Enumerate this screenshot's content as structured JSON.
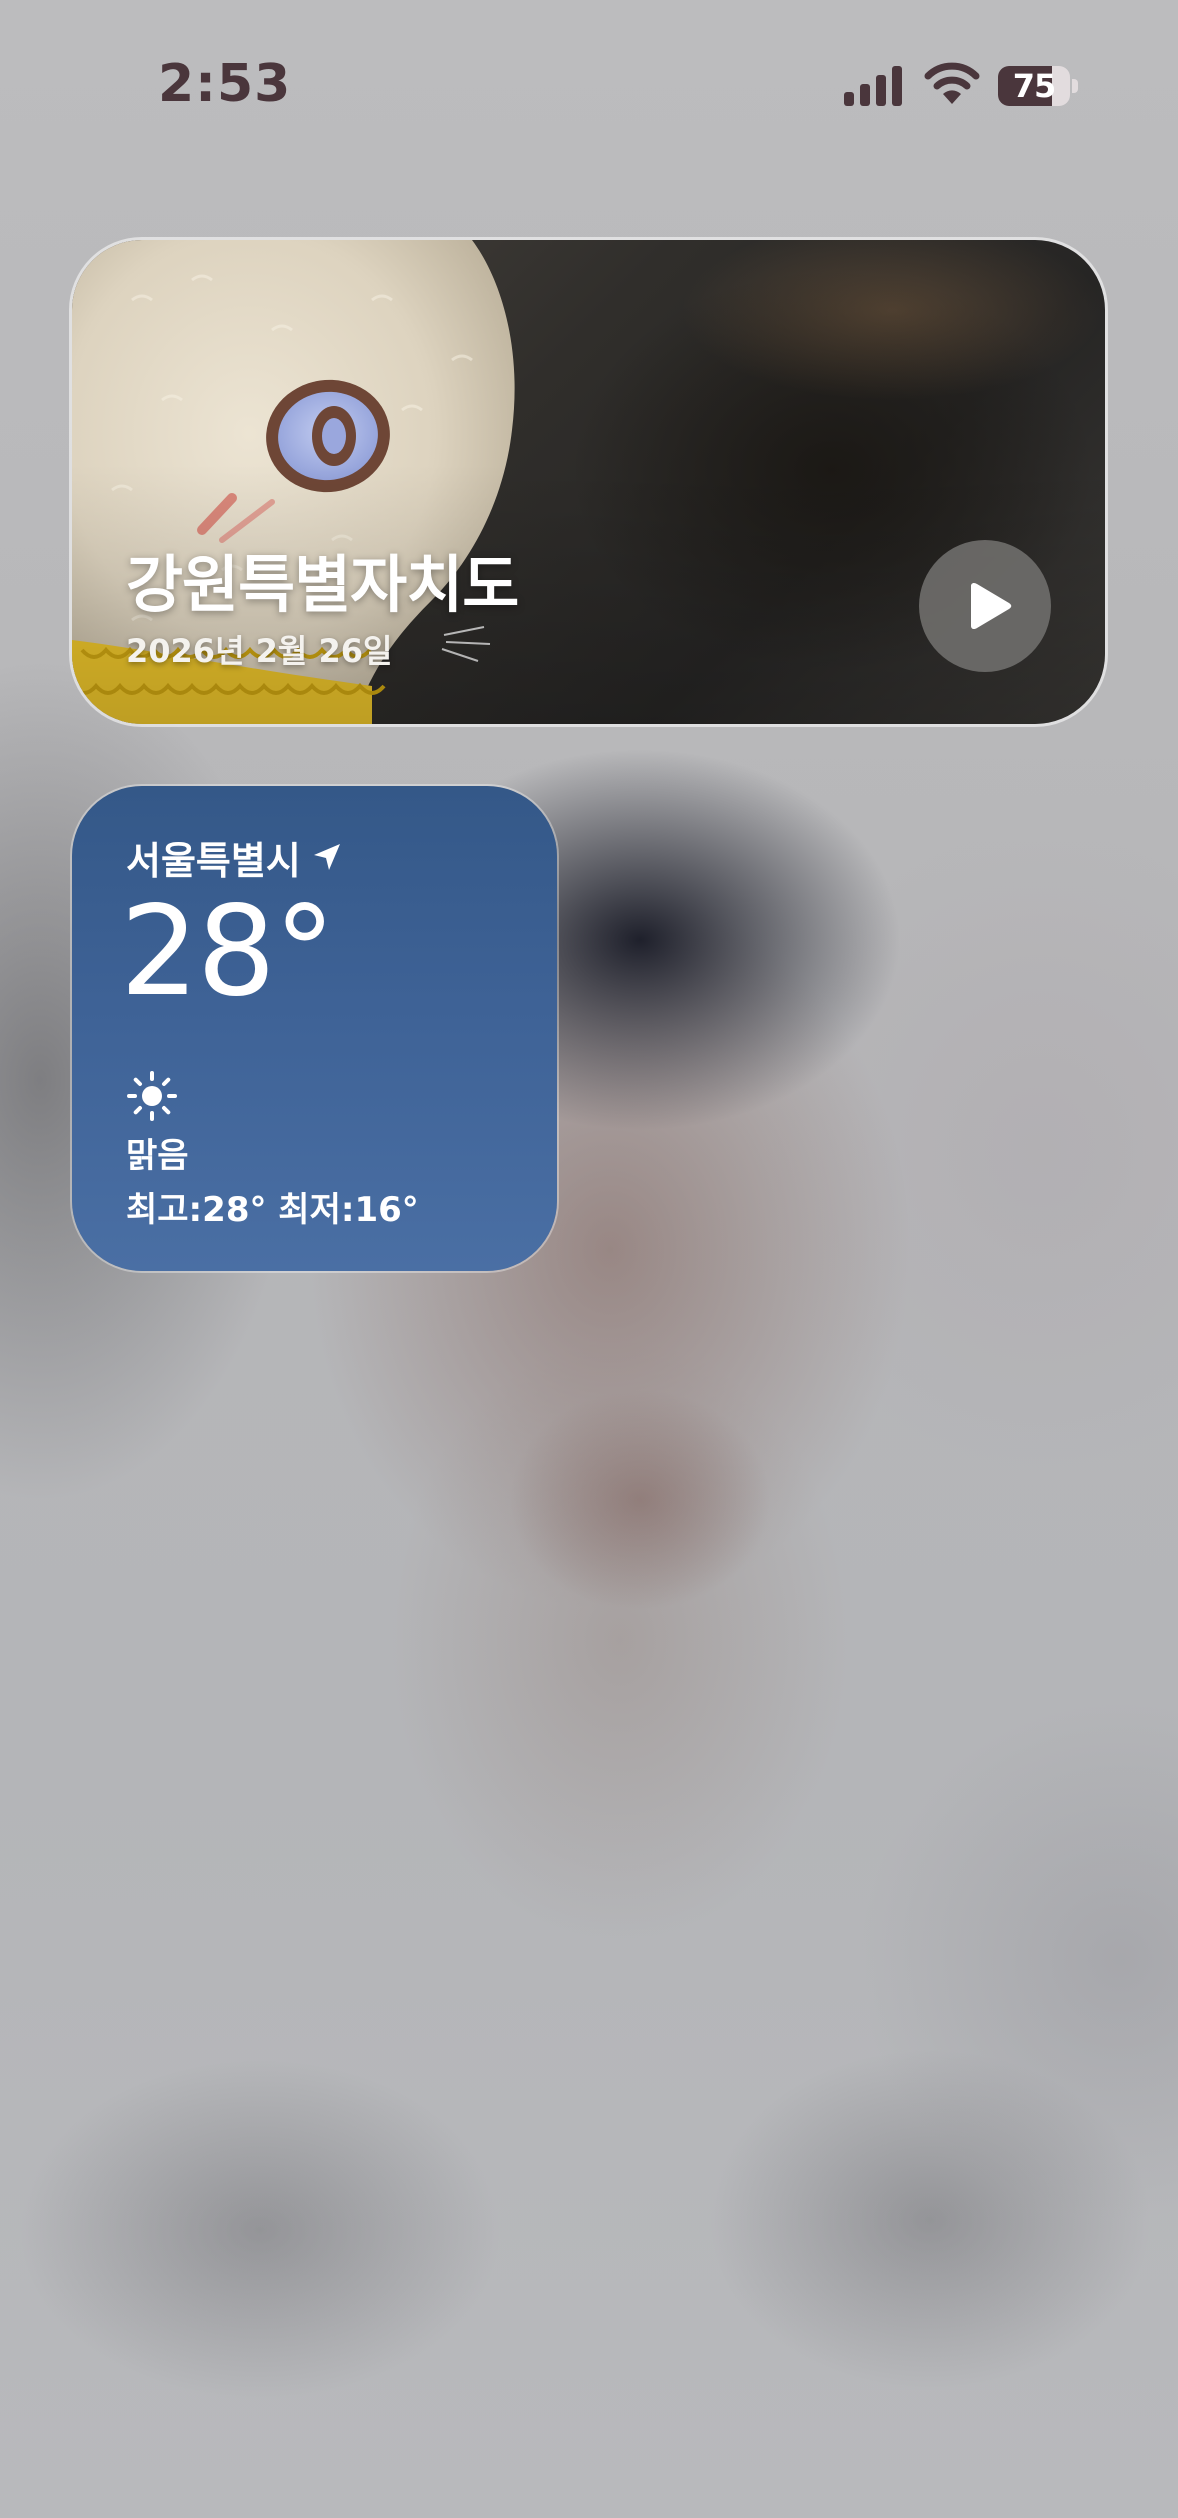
{
  "status_bar": {
    "time": "2:53",
    "battery_level": "75",
    "battery_fraction": 0.75,
    "icons": [
      "cellular-signal-icon",
      "wifi-icon",
      "battery-icon"
    ]
  },
  "photo_widget": {
    "title": "강원특별자치도",
    "date": "2026년 2월 26일",
    "play_icon": "play-icon"
  },
  "weather_widget": {
    "city": "서울특별시",
    "location_icon": "location-arrow-icon",
    "temperature": "28°",
    "condition_icon": "sun-icon",
    "condition": "맑음",
    "high_low": "최고:28° 최저:16°",
    "colors": {
      "background_top": "#345888",
      "background_bottom": "#4a6fa4"
    }
  },
  "colors": {
    "status_text": "#4a363c",
    "wallpaper": "#b9b9bb"
  }
}
